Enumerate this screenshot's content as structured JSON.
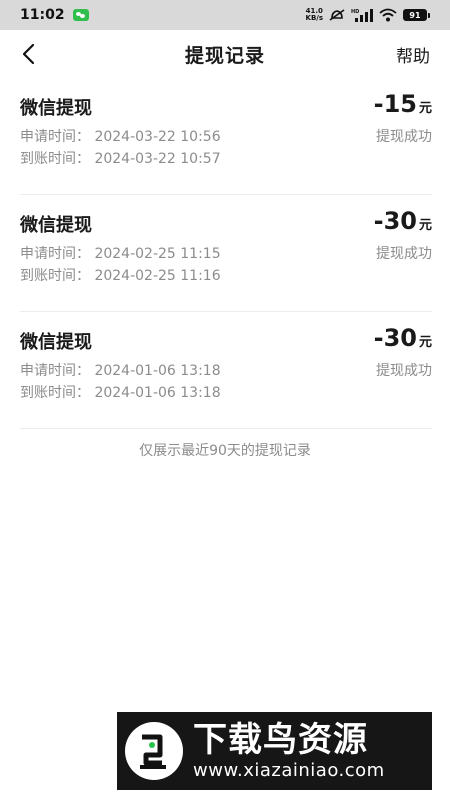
{
  "status_bar": {
    "time": "11:02",
    "net_speed_value": "41.0",
    "net_speed_unit": "KB/s",
    "hd_label": "HD",
    "battery": "91"
  },
  "nav": {
    "title": "提现记录",
    "help": "帮助"
  },
  "records": [
    {
      "title": "微信提现",
      "amount": "-15",
      "unit": "元",
      "apply_time": "申请时间：  2024-03-22 10:56",
      "arrive_time": "到账时间：  2024-03-22 10:57",
      "status": "提现成功"
    },
    {
      "title": "微信提现",
      "amount": "-30",
      "unit": "元",
      "apply_time": "申请时间：  2024-02-25 11:15",
      "arrive_time": "到账时间：  2024-02-25 11:16",
      "status": "提现成功"
    },
    {
      "title": "微信提现",
      "amount": "-30",
      "unit": "元",
      "apply_time": "申请时间：  2024-01-06 13:18",
      "arrive_time": "到账时间：  2024-01-06 13:18",
      "status": "提现成功"
    }
  ],
  "footnote": "仅展示最近90天的提现记录",
  "watermark": {
    "name": "下载鸟资源",
    "url": "www.xiazainiao.com"
  }
}
